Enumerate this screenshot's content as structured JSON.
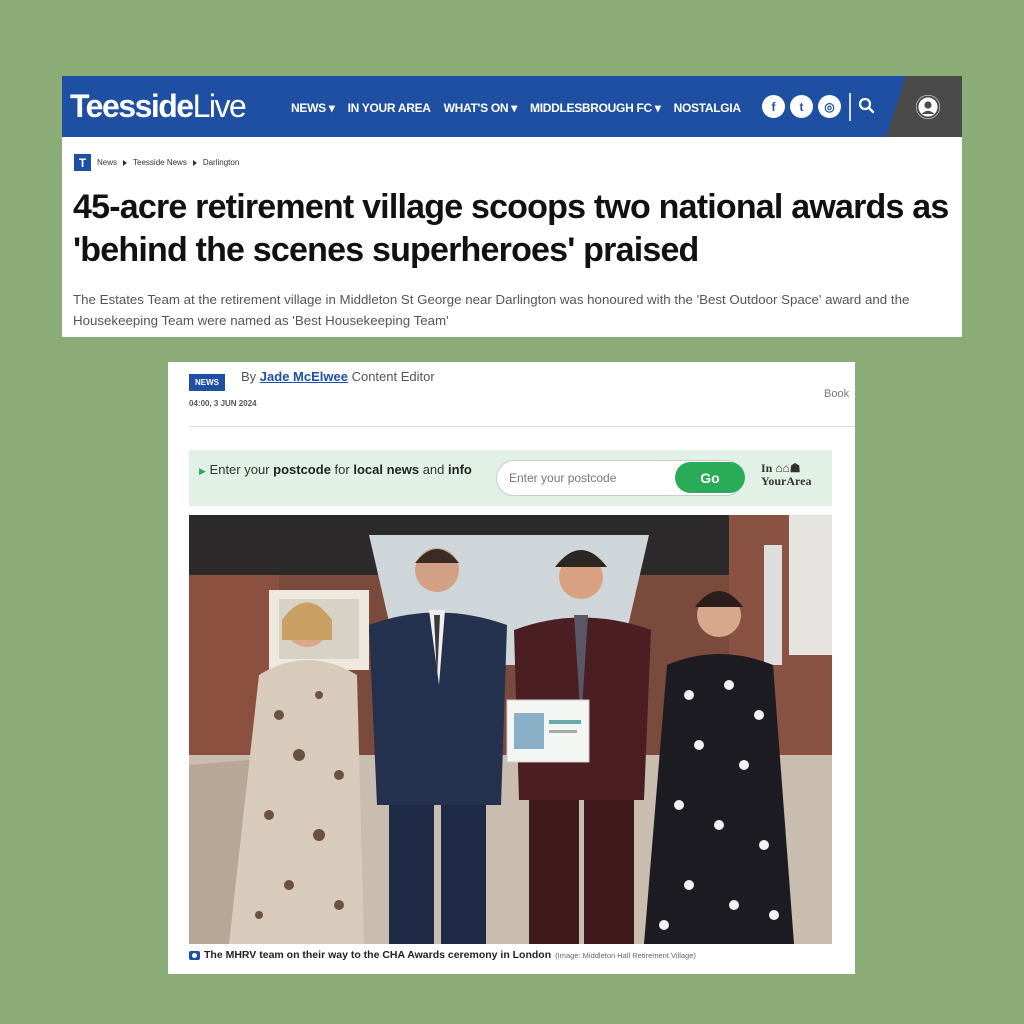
{
  "header": {
    "logo_bold": "Teesside",
    "logo_light": "Live",
    "nav": [
      {
        "label": "NEWS ▾"
      },
      {
        "label": "IN YOUR AREA"
      },
      {
        "label": "WHAT'S ON ▾"
      },
      {
        "label": "MIDDLESBROUGH FC ▾"
      },
      {
        "label": "NOSTALGIA"
      }
    ],
    "social": [
      {
        "icon": "facebook-icon",
        "glyph": "f"
      },
      {
        "icon": "twitter-icon",
        "glyph": "t"
      },
      {
        "icon": "instagram-icon",
        "glyph": "◎"
      }
    ],
    "colors": {
      "brand": "#1e4fa3",
      "account_bg": "#4a4a4a"
    }
  },
  "breadcrumb": {
    "logo": "T",
    "items": [
      "News",
      "Teesside News",
      "Darlington"
    ]
  },
  "article": {
    "headline": "45-acre retirement village scoops two national awards as 'behind the scenes superheroes' praised",
    "standfirst": "The Estates Team at the retirement village in Middleton St George near Darlington was honoured with the 'Best Outdoor Space' award and the Housekeeping Team were named as 'Best Housekeeping Team'",
    "badge": "NEWS",
    "by": "By",
    "author": "Jade McElwee",
    "role": "Content Editor",
    "date": "04:00, 3 JUN 2024",
    "book_text": "Book"
  },
  "postcode": {
    "text_1": "Enter your ",
    "text_2": "postcode",
    "text_3": " for ",
    "text_4": "local news",
    "text_5": " and ",
    "text_6": "info",
    "placeholder": "Enter your postcode",
    "go_label": "Go",
    "brand_line_1": "In ⌂⌂☗",
    "brand_line_2": "YourArea",
    "accent": "#2aab57"
  },
  "photo": {
    "caption": "The MHRV team on their way to the CHA Awards ceremony in London",
    "credit": "(Image: Middleton Hall Retirement Village)"
  }
}
